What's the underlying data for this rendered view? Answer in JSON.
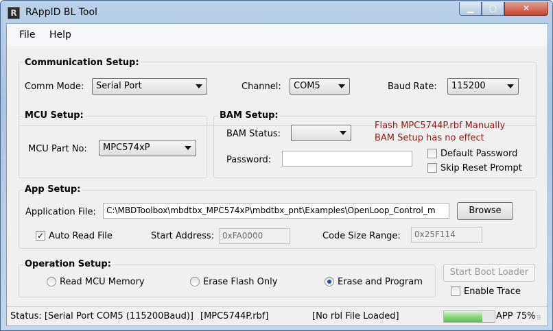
{
  "window": {
    "title": "RAppID BL Tool",
    "app_icon": "R",
    "min_glyph": "▁",
    "max_glyph": "▢",
    "close_glyph": "✕"
  },
  "menu": {
    "file": "File",
    "help": "Help"
  },
  "comm": {
    "title": "Communication Setup:",
    "mode_label": "Comm Mode:",
    "mode_value": "Serial Port",
    "channel_label": "Channel:",
    "channel_value": "COM5",
    "baud_label": "Baud Rate:",
    "baud_value": "115200"
  },
  "mcu": {
    "title": "MCU Setup:",
    "part_label": "MCU Part No:",
    "part_value": "MPC574xP"
  },
  "bam": {
    "title": "BAM Setup:",
    "status_label": "BAM Status:",
    "status_value": "",
    "password_label": "Password:",
    "password_value": "",
    "warning1": "Flash MPC5744P.rbf Manually",
    "warning2": "BAM Setup has no effect",
    "default_password": "Default Password",
    "default_password_checked": false,
    "skip_reset": "Skip Reset Prompt",
    "skip_reset_checked": false
  },
  "app": {
    "title": "App Setup:",
    "file_label": "Application File:",
    "file_value": "C:\\MBDToolbox\\mbdtbx_MPC574xP\\mbdtbx_pnt\\Examples\\OpenLoop_Control_m",
    "browse": "Browse",
    "auto_read": "Auto Read File",
    "auto_read_checked": true,
    "start_label": "Start Address:",
    "start_value": "0xFA0000",
    "size_label": "Code Size Range:",
    "size_value": "0x25F114"
  },
  "op": {
    "title": "Operation Setup:",
    "read": "Read MCU Memory",
    "erase": "Erase Flash Only",
    "erase_program": "Erase and Program",
    "selected": "erase_program",
    "start_boot": "Start Boot Loader",
    "enable_trace": "Enable Trace",
    "enable_trace_checked": false
  },
  "status": {
    "conn": "Status: [Serial Port COM5 (115200Baud)]",
    "rbf": "[MPC5744P.rbf]",
    "rbl": "[No rbl File Loaded]",
    "progress": 0.75,
    "progress_label": "APP 75%"
  },
  "colors": {
    "warning": "#8b1a1a",
    "progress": "#5cbb4e"
  }
}
